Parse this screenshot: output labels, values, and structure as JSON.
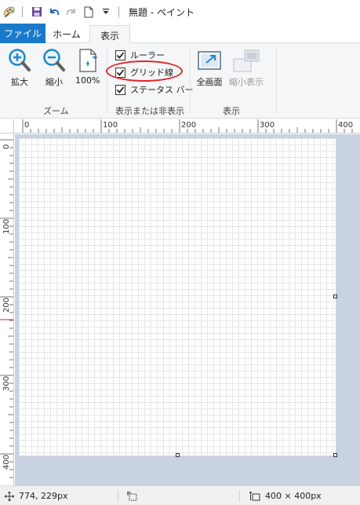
{
  "window": {
    "title": "無題 - ペイント"
  },
  "tabs": {
    "file": "ファイル",
    "home": "ホーム",
    "view": "表示"
  },
  "ribbon": {
    "zoom_group": {
      "label": "ズーム",
      "zoom_in": "拡大",
      "zoom_out": "縮小",
      "zoom_100": "100%"
    },
    "show_hide_group": {
      "label": "表示または非表示",
      "rulers": {
        "label": "ルーラー",
        "checked": true
      },
      "gridlines": {
        "label": "グリッド線",
        "checked": true
      },
      "statusbar": {
        "label": "ステータス バー",
        "checked": true
      }
    },
    "display_group": {
      "label": "表示",
      "fullscreen": "全画面",
      "thumbnail": "縮小表示"
    }
  },
  "rulers": {
    "horizontal_ticks": [
      "0",
      "100",
      "200",
      "300",
      "400"
    ],
    "vertical_ticks": [
      "0",
      "100",
      "200",
      "300",
      "400"
    ]
  },
  "status": {
    "cursor_position": "774, 229px",
    "selection_size": "",
    "canvas_size": "400 × 400px"
  },
  "colors": {
    "file_tab": "#1979ca",
    "highlight_ellipse": "#e0262a",
    "workspace": "#c8d2e0"
  }
}
